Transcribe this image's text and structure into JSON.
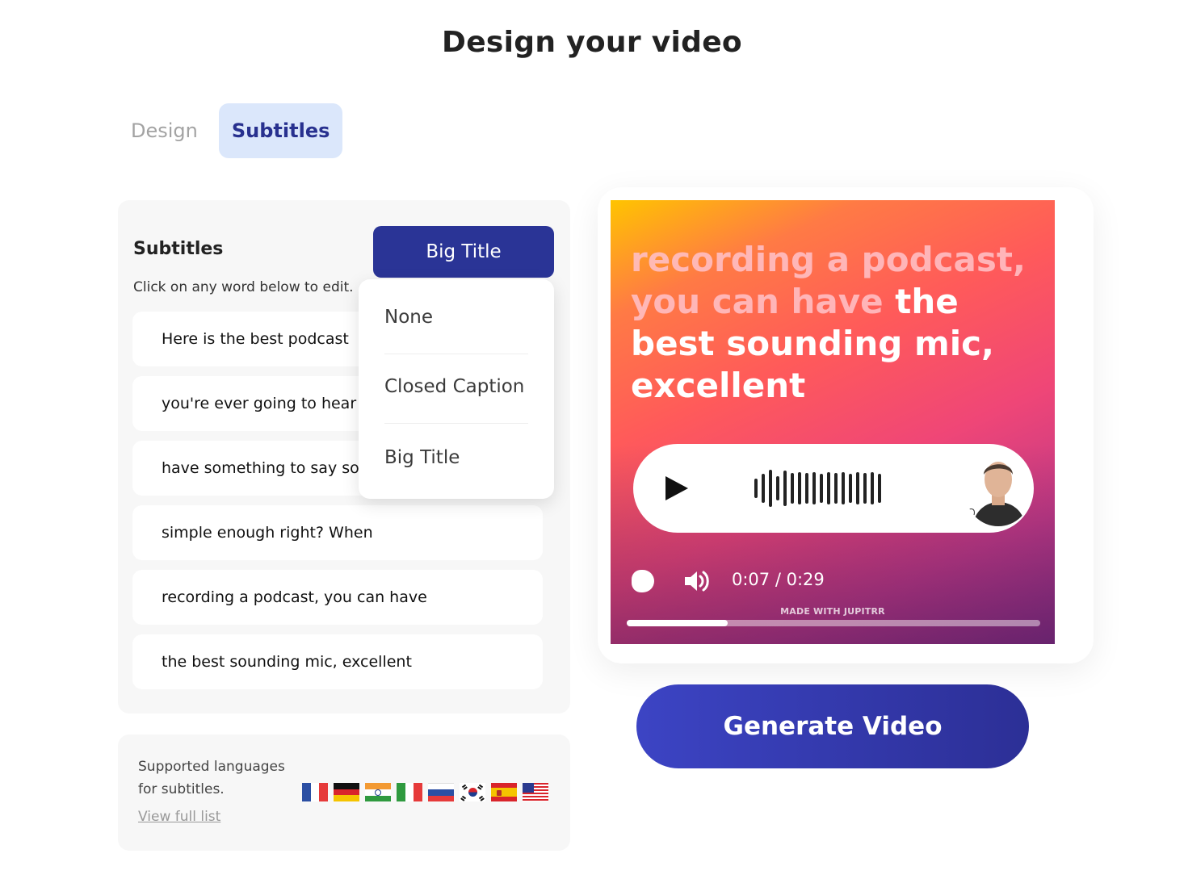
{
  "page": {
    "title": "Design your video"
  },
  "tabs": [
    {
      "label": "Design",
      "active": false
    },
    {
      "label": "Subtitles",
      "active": true
    }
  ],
  "subtitles_panel": {
    "heading": "Subtitles",
    "hint": "Click on any word below to edit.",
    "style_button_label": "Big Title",
    "lines": [
      "Here is the best podcast",
      "you're ever going to hear",
      "have something to say so",
      "simple enough right? When",
      "recording a podcast, you can have",
      "the best sounding mic, excellent"
    ]
  },
  "style_dropdown": {
    "options": [
      "None",
      "Closed Caption",
      "Big Title"
    ],
    "selected": "Big Title"
  },
  "languages": {
    "text_line1": "Supported languages",
    "text_line2": "for subtitles.",
    "link_label": "View full list",
    "flags": [
      "france-flag",
      "germany-flag",
      "india-flag",
      "italy-flag",
      "russia-flag",
      "south-korea-flag",
      "spain-flag",
      "usa-flag"
    ]
  },
  "preview": {
    "caption_faded": "recording a podcast, you can have",
    "caption_bold": "the best sounding mic, excellent",
    "time_display": "0:07 / 0:29",
    "watermark": "MADE WITH JUPITRR",
    "progress": 0.245,
    "gradient_colors": [
      "#ffc400",
      "#ff5a5a",
      "#ef4677",
      "#8c2f86"
    ]
  },
  "actions": {
    "generate_label": "Generate Video"
  },
  "colors": {
    "accent": "#2a3496",
    "tab_active_bg": "#dbe7fb",
    "panel_bg": "#f7f7f7"
  }
}
